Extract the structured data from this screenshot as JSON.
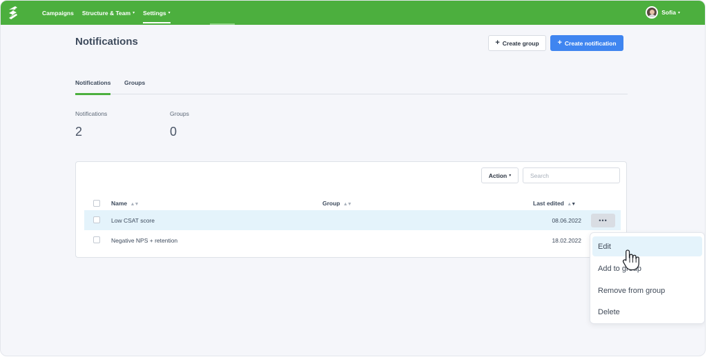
{
  "topbar": {
    "nav": [
      {
        "label": "Campaigns",
        "caret": false
      },
      {
        "label": "Structure & Team",
        "caret": true
      },
      {
        "label": "Settings",
        "caret": true,
        "active": true
      }
    ],
    "user_name": "Sofia",
    "caret": "▾"
  },
  "header": {
    "title": "Notifications",
    "create_group_label": "Create group",
    "create_notification_label": "Create notification",
    "plus": "+"
  },
  "tabs": [
    {
      "label": "Notifications",
      "active": true
    },
    {
      "label": "Groups",
      "active": false
    }
  ],
  "stats": [
    {
      "label": "Notifications",
      "value": "2"
    },
    {
      "label": "Groups",
      "value": "0"
    }
  ],
  "table": {
    "action_label": "Action",
    "search_placeholder": "Search",
    "columns": {
      "name": "Name",
      "group": "Group",
      "last_edited": "Last edited"
    },
    "sort_up": "▲",
    "sort_down": "▼",
    "rows": [
      {
        "name": "Low CSAT score",
        "group": "",
        "last_edited": "08.06.2022",
        "highlighted": true
      },
      {
        "name": "Negative NPS + retention",
        "group": "",
        "last_edited": "18.02.2022",
        "highlighted": false
      }
    ],
    "more_label": "•••"
  },
  "context_menu": {
    "items": [
      "Edit",
      "Add to group",
      "Remove from group",
      "Delete"
    ],
    "hovered": "Edit"
  },
  "colors": {
    "topbar": "#4caf3e",
    "primary": "#3f85f0",
    "row_highlight": "#e4f3fb"
  },
  "icons": {
    "logo": "brand-logo-icon",
    "cursor": "hand-pointer-icon"
  }
}
